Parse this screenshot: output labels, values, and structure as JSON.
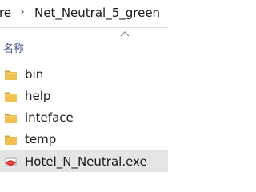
{
  "breadcrumb": {
    "previous": "re",
    "separator": "›",
    "current": "Net_Neutral_5_green"
  },
  "columns": {
    "name_label": "名称",
    "sort_icon": "chevron-up-icon"
  },
  "files": [
    {
      "name": "bin",
      "type": "folder",
      "icon": "folder-icon"
    },
    {
      "name": "help",
      "type": "folder",
      "icon": "folder-icon"
    },
    {
      "name": "inteface",
      "type": "folder",
      "icon": "folder-icon"
    },
    {
      "name": "temp",
      "type": "folder",
      "icon": "folder-icon"
    },
    {
      "name": "Hotel_N_Neutral.exe",
      "type": "application",
      "icon": "app-icon",
      "selected": true
    }
  ],
  "colors": {
    "folder": "#e8b84a",
    "folder_dark": "#d4a033",
    "selection": "#e5e5e5",
    "header_text": "#4a5a8a"
  }
}
